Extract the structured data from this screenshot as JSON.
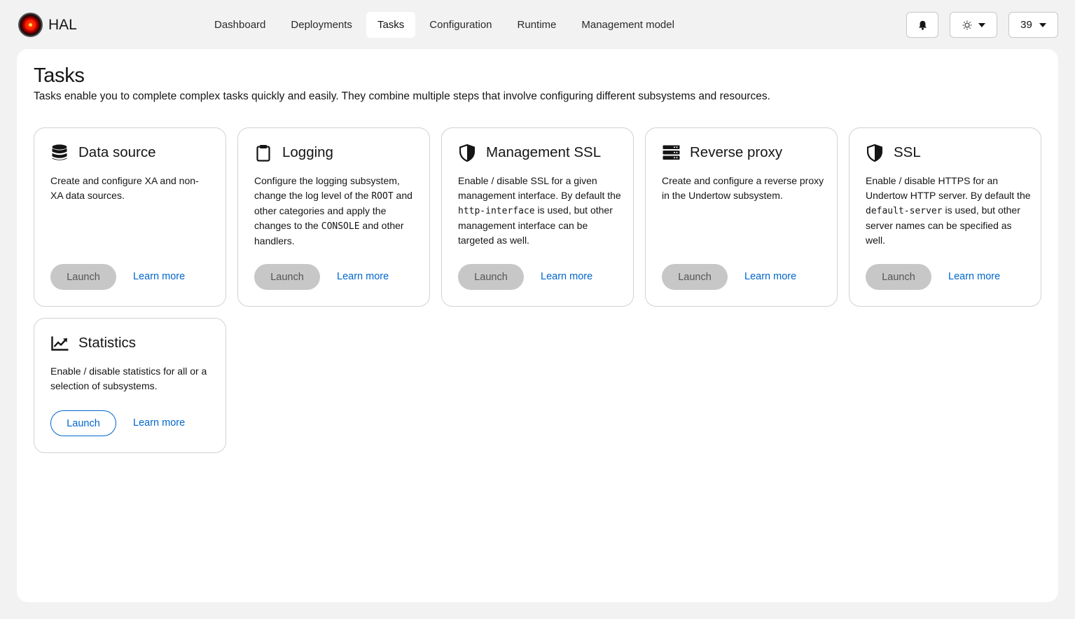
{
  "app": {
    "name": "HAL",
    "logo_icon": "hal-eye-logo"
  },
  "nav": {
    "items": [
      {
        "label": "Dashboard",
        "active": false
      },
      {
        "label": "Deployments",
        "active": false
      },
      {
        "label": "Tasks",
        "active": true
      },
      {
        "label": "Configuration",
        "active": false
      },
      {
        "label": "Runtime",
        "active": false
      },
      {
        "label": "Management model",
        "active": false
      }
    ]
  },
  "toolbar": {
    "notifications_icon": "bell-icon",
    "theme_icon": "sun-icon",
    "version_label": "39"
  },
  "page": {
    "title": "Tasks",
    "description": "Tasks enable you to complete complex tasks quickly and easily. They combine multiple steps that involve configuring different subsystems and resources."
  },
  "cards": [
    {
      "icon": "database-icon",
      "title": "Data source",
      "body": [
        "Create and configure XA and non-",
        "XA data sources."
      ],
      "launch_label": "Launch",
      "launch_enabled": false,
      "learn_label": "Learn more"
    },
    {
      "icon": "clipboard-icon",
      "title": "Logging",
      "body_html_parts": [
        "Configure the logging subsystem, change the log level of the ",
        "ROOT",
        " and other categories and apply the changes to the ",
        "CONSOLE",
        " and other handlers."
      ],
      "launch_label": "Launch",
      "launch_enabled": false,
      "learn_label": "Learn more"
    },
    {
      "icon": "shield-icon",
      "title": "Management SSL",
      "body_html_parts": [
        "Enable / disable SSL for a given management interface. By default the ",
        "http-interface",
        " is used, but other management interface can be targeted as well."
      ],
      "launch_label": "Launch",
      "launch_enabled": false,
      "learn_label": "Learn more"
    },
    {
      "icon": "server-icon",
      "title": "Reverse proxy",
      "body": [
        "Create and configure a reverse proxy in the Undertow subsystem."
      ],
      "launch_label": "Launch",
      "launch_enabled": false,
      "learn_label": "Learn more"
    },
    {
      "icon": "shield-icon",
      "title": "SSL",
      "body_html_parts": [
        "Enable / disable HTTPS for an Undertow HTTP server. By default the ",
        "default-server",
        " is used, but other server names can be specified as well."
      ],
      "launch_label": "Launch",
      "launch_enabled": false,
      "learn_label": "Learn more"
    },
    {
      "icon": "chart-line-icon",
      "title": "Statistics",
      "body": [
        "Enable / disable statistics for all or a selection of subsystems."
      ],
      "launch_label": "Launch",
      "launch_enabled": true,
      "learn_label": "Learn more"
    }
  ],
  "colors": {
    "accent": "#0066cc",
    "disabled_button": "#c7c7c7",
    "page_bg": "#f2f2f2"
  }
}
